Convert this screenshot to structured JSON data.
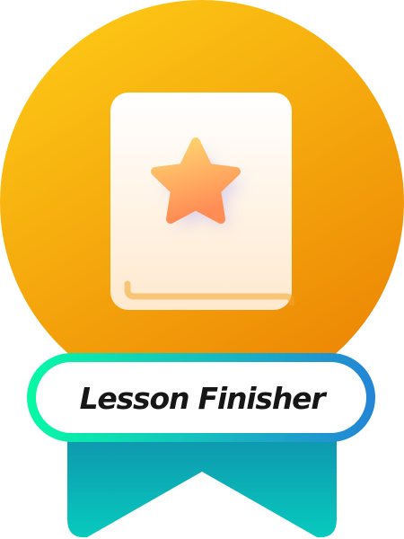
{
  "badge": {
    "title": "Lesson Finisher",
    "icon": "book-star-icon",
    "colors": {
      "medal_top": "#fdc815",
      "medal_bottom": "#ec8404",
      "book": "#fff3e3",
      "star_top": "#ffd872",
      "star_bottom": "#ff8c55",
      "border_left": "#08f8a6",
      "border_right": "#2386d6",
      "ribbon_top": "#0f94ae",
      "ribbon_bottom": "#07cabd"
    }
  }
}
